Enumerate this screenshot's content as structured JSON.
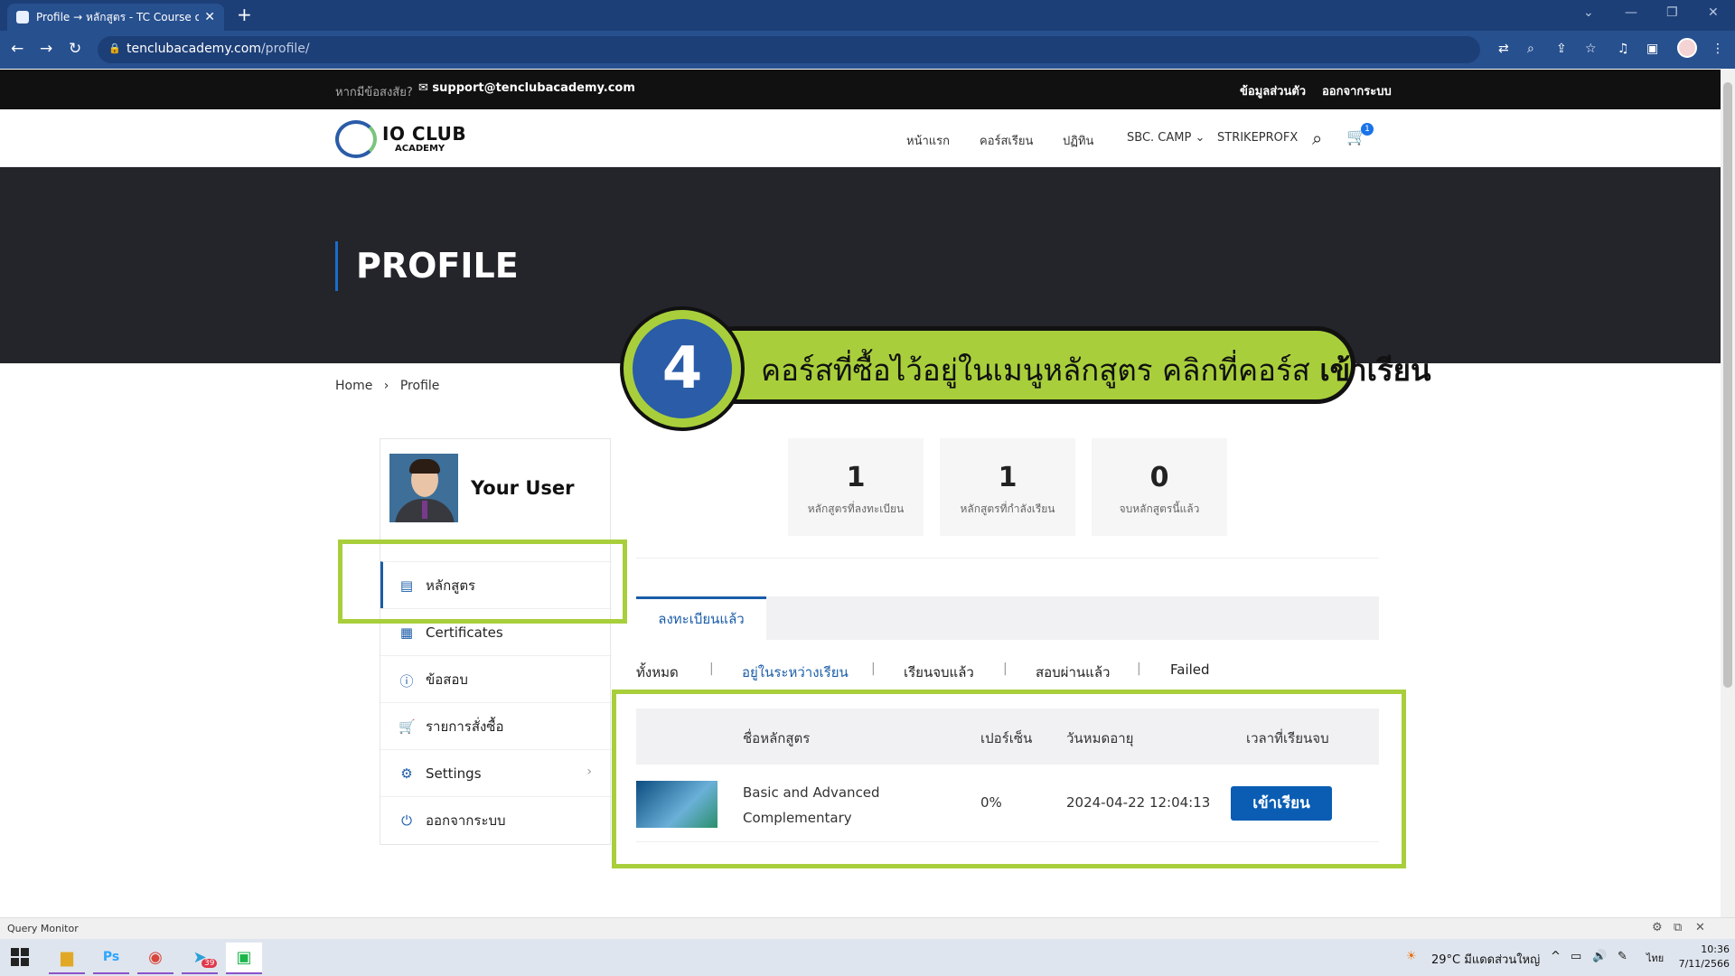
{
  "browser": {
    "tab_title": "Profile → หลักสูตร - TC Course on",
    "url_host": "tenclubacademy.com",
    "url_path": "/profile/"
  },
  "topbar": {
    "question": "หากมีข้อสงสัย?",
    "email": "support@tenclubacademy.com",
    "account_link": "ข้อมูลส่วนตัว",
    "logout_link": "ออกจากระบบ"
  },
  "logo": {
    "name": "IO CLUB",
    "sub": "ACADEMY"
  },
  "nav": {
    "home": "หน้าแรก",
    "courses": "คอร์สเรียน",
    "calendar": "ปฏิทิน",
    "camp": "SBC. CAMP",
    "strike": "STRIKEPROFX",
    "cart_count": "1"
  },
  "hero": {
    "title": "PROFILE"
  },
  "callout": {
    "number": "4",
    "text": "คอร์สที่ซื้อไว้อยู่ในเมนูหลักสูตร คลิกที่คอร์ส",
    "bold": "เข้าเรียน"
  },
  "breadcrumb": {
    "home": "Home",
    "sep": "›",
    "current": "Profile"
  },
  "user": {
    "name": "Your User"
  },
  "menu": {
    "courses": "หลักสูตร",
    "certificates": "Certificates",
    "quiz": "ข้อสอบ",
    "orders": "รายการสั่งซื้อ",
    "settings": "Settings",
    "logout": "ออกจากระบบ"
  },
  "stats": [
    {
      "value": "1",
      "label": "หลักสูตรที่ลงทะเบียน"
    },
    {
      "value": "1",
      "label": "หลักสูตรที่กำลังเรียน"
    },
    {
      "value": "0",
      "label": "จบหลักสูตรนี้แล้ว"
    }
  ],
  "tabs": {
    "enrolled": "ลงทะเบียนแล้ว"
  },
  "filters": {
    "all": "ทั้งหมด",
    "in_progress": "อยู่ในระหว่างเรียน",
    "finished": "เรียนจบแล้ว",
    "passed": "สอบผ่านแล้ว",
    "failed": "Failed"
  },
  "table": {
    "headers": {
      "name": "ชื่อหลักสูตร",
      "percent": "เปอร์เซ็น",
      "expiry": "วันหมดอายุ",
      "finish_time": "เวลาที่เรียนจบ"
    },
    "rows": [
      {
        "name": "Basic and Advanced Complementary",
        "percent": "0%",
        "expiry": "2024-04-22 12:04:13",
        "action": "เข้าเรียน"
      }
    ]
  },
  "query_monitor": "Query Monitor",
  "taskbar": {
    "weather": "29°C  มีแดดส่วนใหญ่",
    "lang": "ไทย",
    "time": "10:36",
    "date": "7/11/2566",
    "telegram_badge": "39"
  },
  "colors": {
    "accent": "#1a5ca8",
    "highlight": "#a8cf3b",
    "hero_bg": "#24252a"
  }
}
